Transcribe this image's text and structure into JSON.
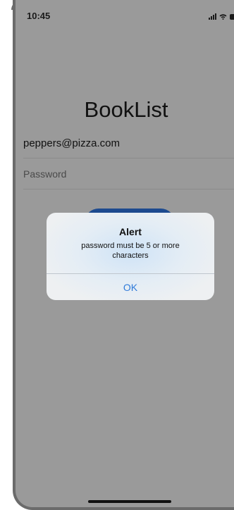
{
  "status_bar": {
    "time": "10:45",
    "icons": [
      "signal-icon",
      "wifi-icon",
      "battery-icon"
    ]
  },
  "app": {
    "title": "BookList",
    "email_value": "peppers@pizza.com",
    "password_placeholder": "Password"
  },
  "alert": {
    "title": "Alert",
    "message": "password must be 5 or more characters",
    "ok_label": "OK"
  },
  "colors": {
    "dim_background": "#9a9a9a",
    "button": "#1d4a8f",
    "alert_action": "#2f7ad9"
  }
}
